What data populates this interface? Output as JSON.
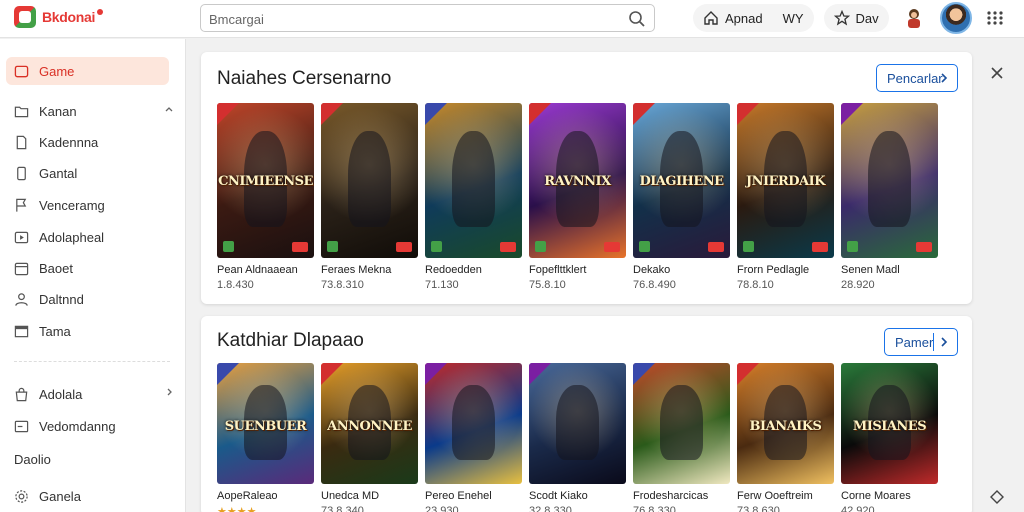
{
  "app": {
    "logo_text": "Bkdonai"
  },
  "search": {
    "placeholder": "Bmcargai"
  },
  "topbar": {
    "pill_1_label": "Apnad",
    "pill_1_suffix": "WY",
    "pill_2_label": "Dav"
  },
  "sidebar": {
    "items": [
      {
        "label": "Game",
        "icon": "game-controller-icon",
        "active": true
      },
      {
        "label": "Kanan",
        "icon": "folder-icon",
        "chevron": true
      },
      {
        "label": "Kadennna",
        "icon": "document-icon"
      },
      {
        "label": "Gantal",
        "icon": "phone-icon"
      },
      {
        "label": "Venceramg",
        "icon": "flag-icon"
      },
      {
        "label": "Adolapheal",
        "icon": "play-box-icon"
      },
      {
        "label": "Baoet",
        "icon": "calendar-icon"
      },
      {
        "label": "Daltnnd",
        "icon": "person-icon"
      },
      {
        "label": "Tama",
        "icon": "window-icon"
      },
      {
        "label": "Adolala",
        "icon": "bag-icon",
        "chevron": true
      },
      {
        "label": "Vedomdanng",
        "icon": "tablet-icon"
      }
    ],
    "section_label": "Daolio",
    "footer_item": {
      "label": "Ganela",
      "icon": "settings-icon"
    }
  },
  "panels": [
    {
      "title": "Naiahes Cersenarno",
      "button_label": "Pencarlar",
      "cards": [
        {
          "title": "Pean Aldnaaean",
          "sub": "1.8.430",
          "art": "CNIMIEENSE",
          "colors": [
            "#3b1a12",
            "#c0462a",
            "#1a1010"
          ],
          "badge": "red"
        },
        {
          "title": "Feraes Mekna",
          "sub": "73.8.310",
          "art": "",
          "colors": [
            "#2a2118",
            "#7a5a2a",
            "#100c08"
          ],
          "badge": "red"
        },
        {
          "title": "Redoedden",
          "sub": "71.130",
          "art": "",
          "colors": [
            "#0f3b5a",
            "#c88a2a",
            "#1a4a2a"
          ],
          "badge": "blue"
        },
        {
          "title": "Fopeflttklert",
          "sub": "75.8.10",
          "art": "RAVNNIX",
          "colors": [
            "#2a0f4a",
            "#9a3ad0",
            "#e8732a"
          ],
          "badge": "red"
        },
        {
          "title": "Dekako",
          "sub": "76.8.490",
          "art": "DIAGIHENE",
          "colors": [
            "#12304a",
            "#6aa8d8",
            "#2a1a3a"
          ],
          "badge": "red"
        },
        {
          "title": "Frorn Pedlagle",
          "sub": "78.8.10",
          "art": "JNIERDAIK",
          "colors": [
            "#2a1a10",
            "#c87a2a",
            "#0a3a4a"
          ],
          "badge": "red"
        },
        {
          "title": "Senen Madl",
          "sub": "28.920",
          "art": "",
          "colors": [
            "#3a2a6a",
            "#c8a040",
            "#2a6a3a"
          ],
          "badge": "purple"
        }
      ]
    },
    {
      "title": "Katdhiar Dlapaao",
      "button_label": "Pamer",
      "cards": [
        {
          "title": "AopeRaleao",
          "sub": "★★★★",
          "art": "SUENBUER",
          "colors": [
            "#1a5a8a",
            "#e8a040",
            "#5a2a7a"
          ],
          "badge": "blue"
        },
        {
          "title": "Unedca MD",
          "sub": "73.8.340",
          "art": "ANNONNEE",
          "colors": [
            "#3a2a10",
            "#e8a02a",
            "#1a3a1a"
          ],
          "badge": "red"
        },
        {
          "title": "Pereo Enehel",
          "sub": "23.930",
          "art": "",
          "colors": [
            "#0a3a8a",
            "#c02a2a",
            "#e8c040"
          ],
          "badge": "purple"
        },
        {
          "title": "Scodt Kiako",
          "sub": "32.8.330",
          "art": "",
          "colors": [
            "#1a2a4a",
            "#4a6a9a",
            "#0a0a1a"
          ],
          "badge": "purple"
        },
        {
          "title": "Frodesharcicas",
          "sub": "76.8.330",
          "art": "",
          "colors": [
            "#2a5a1a",
            "#c04a2a",
            "#f0e8c0"
          ],
          "badge": "blue"
        },
        {
          "title": "Ferw Ooeftreim",
          "sub": "73.8.630",
          "art": "BIANAIKS",
          "colors": [
            "#4a2a10",
            "#d8802a",
            "#f0c060"
          ],
          "badge": "red"
        },
        {
          "title": "Corne Moares",
          "sub": "42.920",
          "art": "MISIANES",
          "colors": [
            "#0a0a0a",
            "#2a7a3a",
            "#c02a2a"
          ],
          "badge": "none"
        }
      ]
    }
  ],
  "colors": {
    "accent": "#d93025",
    "active_bg": "#fde6dc",
    "link_blue": "#1a73e8"
  }
}
